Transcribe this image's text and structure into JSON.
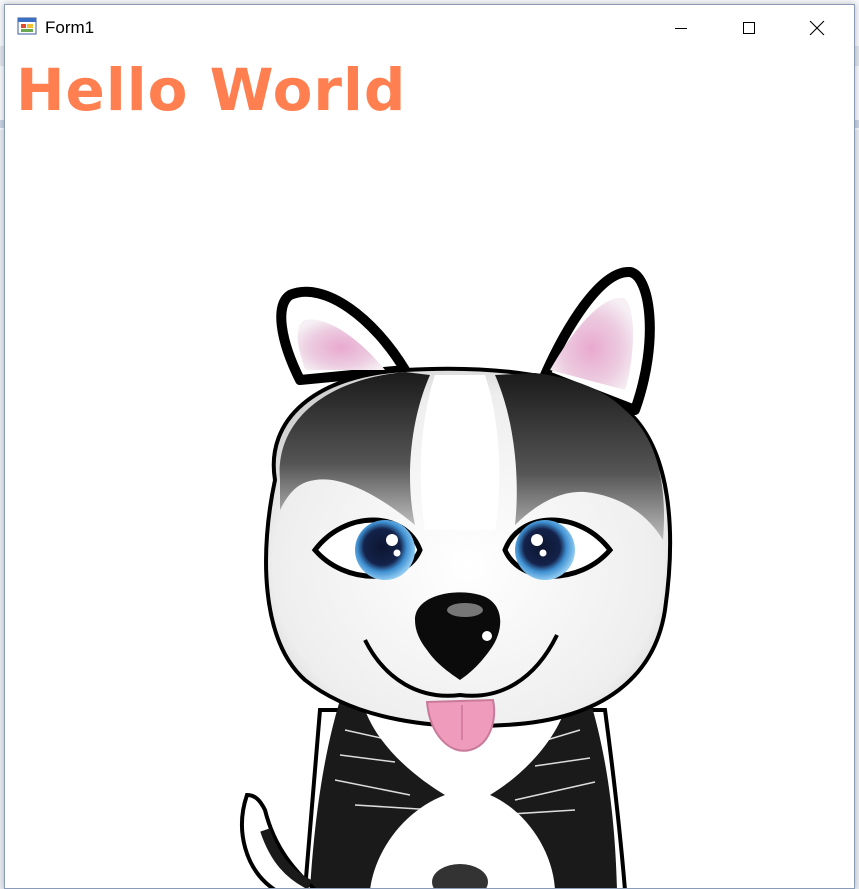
{
  "window": {
    "title": "Form1",
    "app_icon": "winforms-app-icon",
    "controls": {
      "minimize": "minimize-icon",
      "maximize": "maximize-icon",
      "close": "close-icon"
    }
  },
  "content": {
    "label_text": "Hello World",
    "label_color": "#ff7f50",
    "image": "husky-puppy-illustration"
  }
}
